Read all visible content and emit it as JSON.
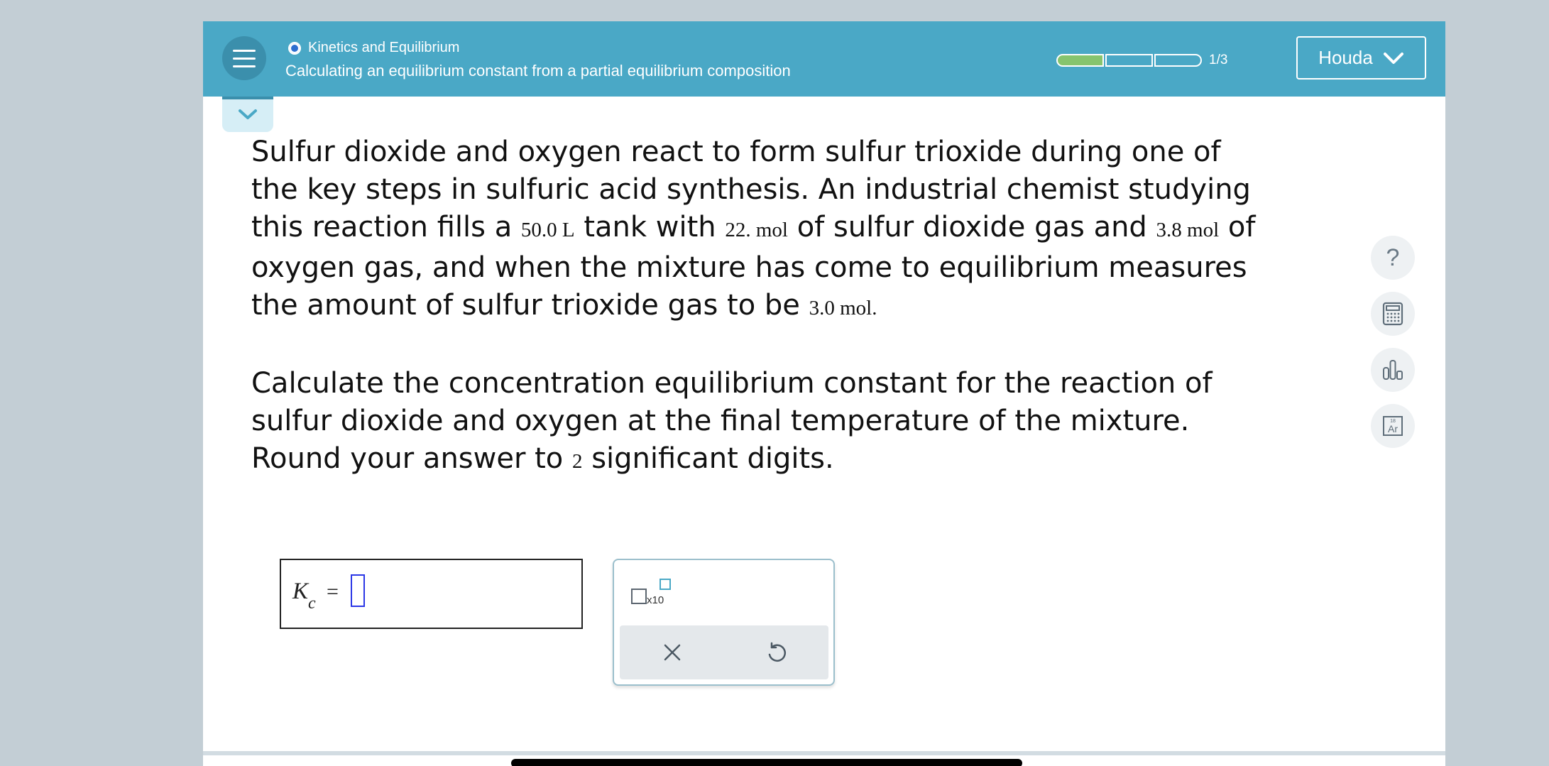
{
  "header": {
    "topic": "Kinetics and Equilibrium",
    "title": "Calculating an equilibrium constant from a partial equilibrium composition",
    "progress_text": "1/3",
    "progress_fraction": 0.333,
    "user_name": "Houda"
  },
  "question": {
    "p1_a": "Sulfur dioxide and oxygen react to form sulfur trioxide during one of the key steps in sulfuric acid synthesis. An industrial chemist studying this reaction fills a ",
    "volume": "50.0 L",
    "p1_b": " tank with ",
    "so2_amount": "22. mol",
    "p1_c": " of sulfur dioxide gas and ",
    "o2_amount": "3.8 mol",
    "p1_d": " of oxygen gas, and when the mixture has come to equilibrium measures the amount of sulfur trioxide gas to be ",
    "so3_amount": "3.0 mol.",
    "p2_a": "Calculate the concentration equilibrium constant for the reaction of sulfur dioxide and oxygen at the final temperature of the mixture. Round your answer to ",
    "sig_digits": "2",
    "p2_b": " significant digits."
  },
  "answer": {
    "symbol": "K",
    "subscript": "c",
    "equals": "="
  },
  "keypad": {
    "sci_label": "x10"
  },
  "tools": [
    "help-icon",
    "calculator-icon",
    "chart-icon",
    "periodic-table-icon"
  ],
  "tool_labels": {
    "help": "?",
    "element_number": "18",
    "element_symbol": "Ar"
  }
}
